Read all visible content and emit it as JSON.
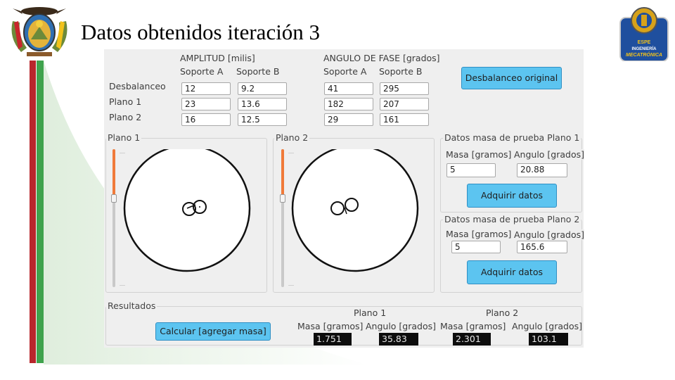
{
  "slide": {
    "title": "Datos obtenidos iteración 3"
  },
  "logos": {
    "left": "ecuador-coat-of-arms-logo",
    "right": "espe-ingenieria-mecatronica-logo",
    "right_text_lines": [
      "ESPE",
      "INGENIERÍA",
      "MECATRÓNICA"
    ]
  },
  "colors": {
    "accent_red": "#b8262c",
    "accent_green": "#3fa34d",
    "button_blue": "#5cc4f0",
    "slider_orange": "#f07a3a"
  },
  "app": {
    "header": {
      "amplitud": "AMPLITUD [milis]",
      "angulo_fase": "ANGULO DE FASE [grados]",
      "soporte_a": "Soporte A",
      "soporte_b": "Soporte B"
    },
    "rows": {
      "desbalanceo": "Desbalanceo",
      "plano1": "Plano 1",
      "plano2": "Plano 2"
    },
    "values": {
      "desbalanceo": {
        "amp_a": "12",
        "amp_b": "9.2",
        "ang_a": "41",
        "ang_b": "295"
      },
      "plano1": {
        "amp_a": "23",
        "amp_b": "13.6",
        "ang_a": "182",
        "ang_b": "207"
      },
      "plano2": {
        "amp_a": "16",
        "amp_b": "12.5",
        "ang_a": "29",
        "ang_b": "161"
      }
    },
    "desbalanceo_original_button": "Desbalanceo original",
    "plano1_panel": {
      "title": "Plano 1",
      "slider_level": 0.35
    },
    "plano2_panel": {
      "title": "Plano 2",
      "slider_level": 0.35
    },
    "masa_plano1": {
      "title": "Datos masa de prueba Plano 1",
      "masa_label": "Masa [gramos]",
      "angulo_label": "Angulo [grados]",
      "masa_value": "5",
      "angulo_value": "20.88",
      "button": "Adquirir datos"
    },
    "masa_plano2": {
      "title": "Datos masa de prueba Plano 2",
      "masa_label": "Masa [gramos]",
      "angulo_label": "Angulo [grados]",
      "masa_value": "5",
      "angulo_value": "165.6",
      "button": "Adquirir datos"
    },
    "resultados": {
      "title": "Resultados",
      "calcular_button": "Calcular [agregar masa]",
      "plano1_label": "Plano 1",
      "plano2_label": "Plano 2",
      "masa_label": "Masa [gramos]",
      "angulo_label": "Angulo [grados]",
      "plano1_masa": "1.751",
      "plano1_angulo": "35.83",
      "plano2_masa": "2.301",
      "plano2_angulo": "103.1"
    }
  }
}
